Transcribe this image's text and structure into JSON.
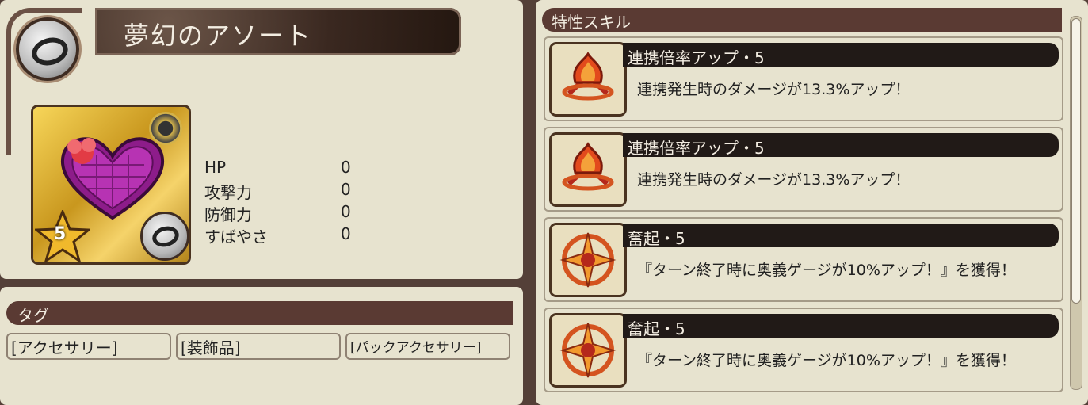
{
  "item": {
    "name": "夢幻のアソート",
    "rarity": "5",
    "icon": "heart-gift-box-icon",
    "type_icon": "ring-icon"
  },
  "stats": [
    {
      "label": "HP",
      "value": "0"
    },
    {
      "label": "攻撃力",
      "value": "0"
    },
    {
      "label": "防御力",
      "value": "0"
    },
    {
      "label": "すばやさ",
      "value": "0"
    }
  ],
  "tags": {
    "header": "タグ",
    "items": [
      "[アクセサリー]",
      "[装飾品]",
      "[パックアクセサリー]"
    ]
  },
  "skills": {
    "header": "特性スキル",
    "items": [
      {
        "name": "連携倍率アップ・5",
        "description": "連携発生時のダメージが13.3%アップ！",
        "icon": "chain-flame-icon"
      },
      {
        "name": "連携倍率アップ・5",
        "description": "連携発生時のダメージが13.3%アップ！",
        "icon": "chain-flame-icon"
      },
      {
        "name": "奮起・5",
        "description": "『ターン終了時に奥義ゲージが10%アップ！』を獲得！",
        "icon": "burst-gauge-icon"
      },
      {
        "name": "奮起・5",
        "description": "『ターン終了時に奥義ゲージが10%アップ！』を獲得！",
        "icon": "burst-gauge-icon"
      }
    ]
  },
  "colors": {
    "accent": "#5a3a33",
    "panel": "#e7e3cf",
    "background": "#544038"
  }
}
